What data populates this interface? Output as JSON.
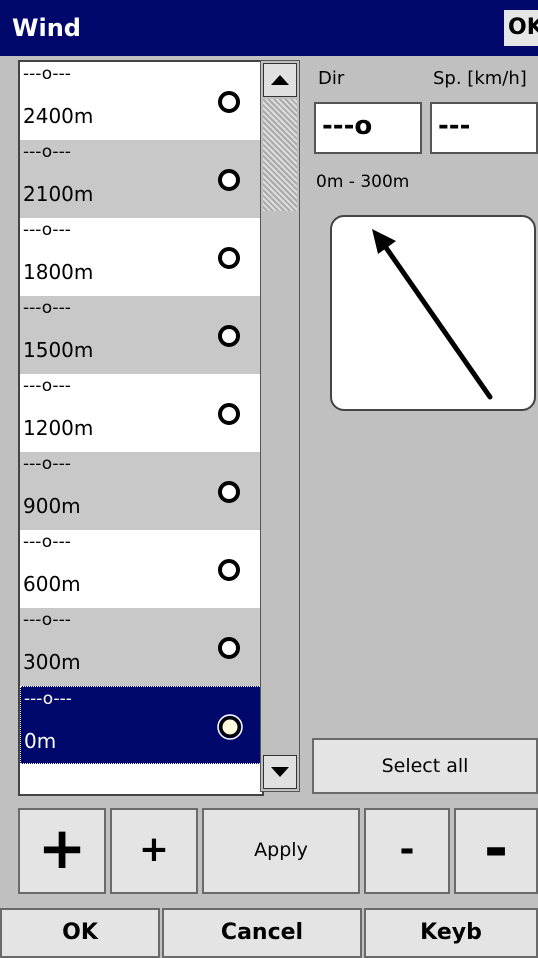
{
  "window": {
    "title": "Wind",
    "ok": "OK"
  },
  "list": {
    "items": [
      {
        "direction": "---o---",
        "altitude": "2400m",
        "style": "white"
      },
      {
        "direction": "---o---",
        "altitude": "2100m",
        "style": "gray"
      },
      {
        "direction": "---o---",
        "altitude": "1800m",
        "style": "white"
      },
      {
        "direction": "---o---",
        "altitude": "1500m",
        "style": "gray"
      },
      {
        "direction": "---o---",
        "altitude": "1200m",
        "style": "white"
      },
      {
        "direction": "---o---",
        "altitude": "900m",
        "style": "gray"
      },
      {
        "direction": "---o---",
        "altitude": "600m",
        "style": "white"
      },
      {
        "direction": "---o---",
        "altitude": "300m",
        "style": "gray"
      },
      {
        "direction": "---o---",
        "altitude": "0m",
        "style": "sel"
      }
    ]
  },
  "panel": {
    "dir_label": "Dir",
    "dir_value": "---o",
    "speed_label": "Sp. [km/h]",
    "speed_value": "---",
    "range": "0m - 300m",
    "select_all": "Select all"
  },
  "buttons": {
    "plus_big": "+",
    "plus_small": "+",
    "apply": "Apply",
    "minus_small": "-",
    "minus_big": "-"
  },
  "footer": {
    "ok": "OK",
    "cancel": "Cancel",
    "keyb": "Keyb"
  },
  "colors": {
    "title_bg": "#00086b",
    "selection": "#00086b",
    "arrow": "#000000"
  },
  "icons": {
    "scroll_up": "triangle-up-icon",
    "scroll_down": "triangle-down-icon",
    "altitude_marker": "circle-ring-icon",
    "wind_arrow": "arrow-icon"
  }
}
